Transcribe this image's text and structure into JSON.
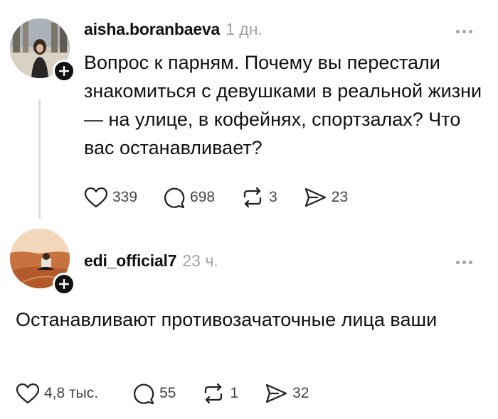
{
  "posts": [
    {
      "username": "aisha.boranbaeva",
      "time": "1 дн.",
      "text": "Вопрос к парням. Почему вы перестали знакомиться с девушками в реальной жизни — на улице, в кофейнях, спортзалах? Что вас останавливает?",
      "likes": "339",
      "comments": "698",
      "reposts": "3",
      "shares": "23"
    },
    {
      "username": "edi_official7",
      "time": "23 ч.",
      "text": "Останавливают противозачаточные лица ваши",
      "likes": "4,8 тыс.",
      "comments": "55",
      "reposts": "1",
      "shares": "32"
    }
  ],
  "colors": {
    "text": "#111111",
    "muted": "#a3a3a3",
    "thread_line": "#dcdcdc"
  },
  "icons": [
    "heart-icon",
    "comment-icon",
    "repost-icon",
    "share-icon",
    "more-icon",
    "plus-icon"
  ]
}
